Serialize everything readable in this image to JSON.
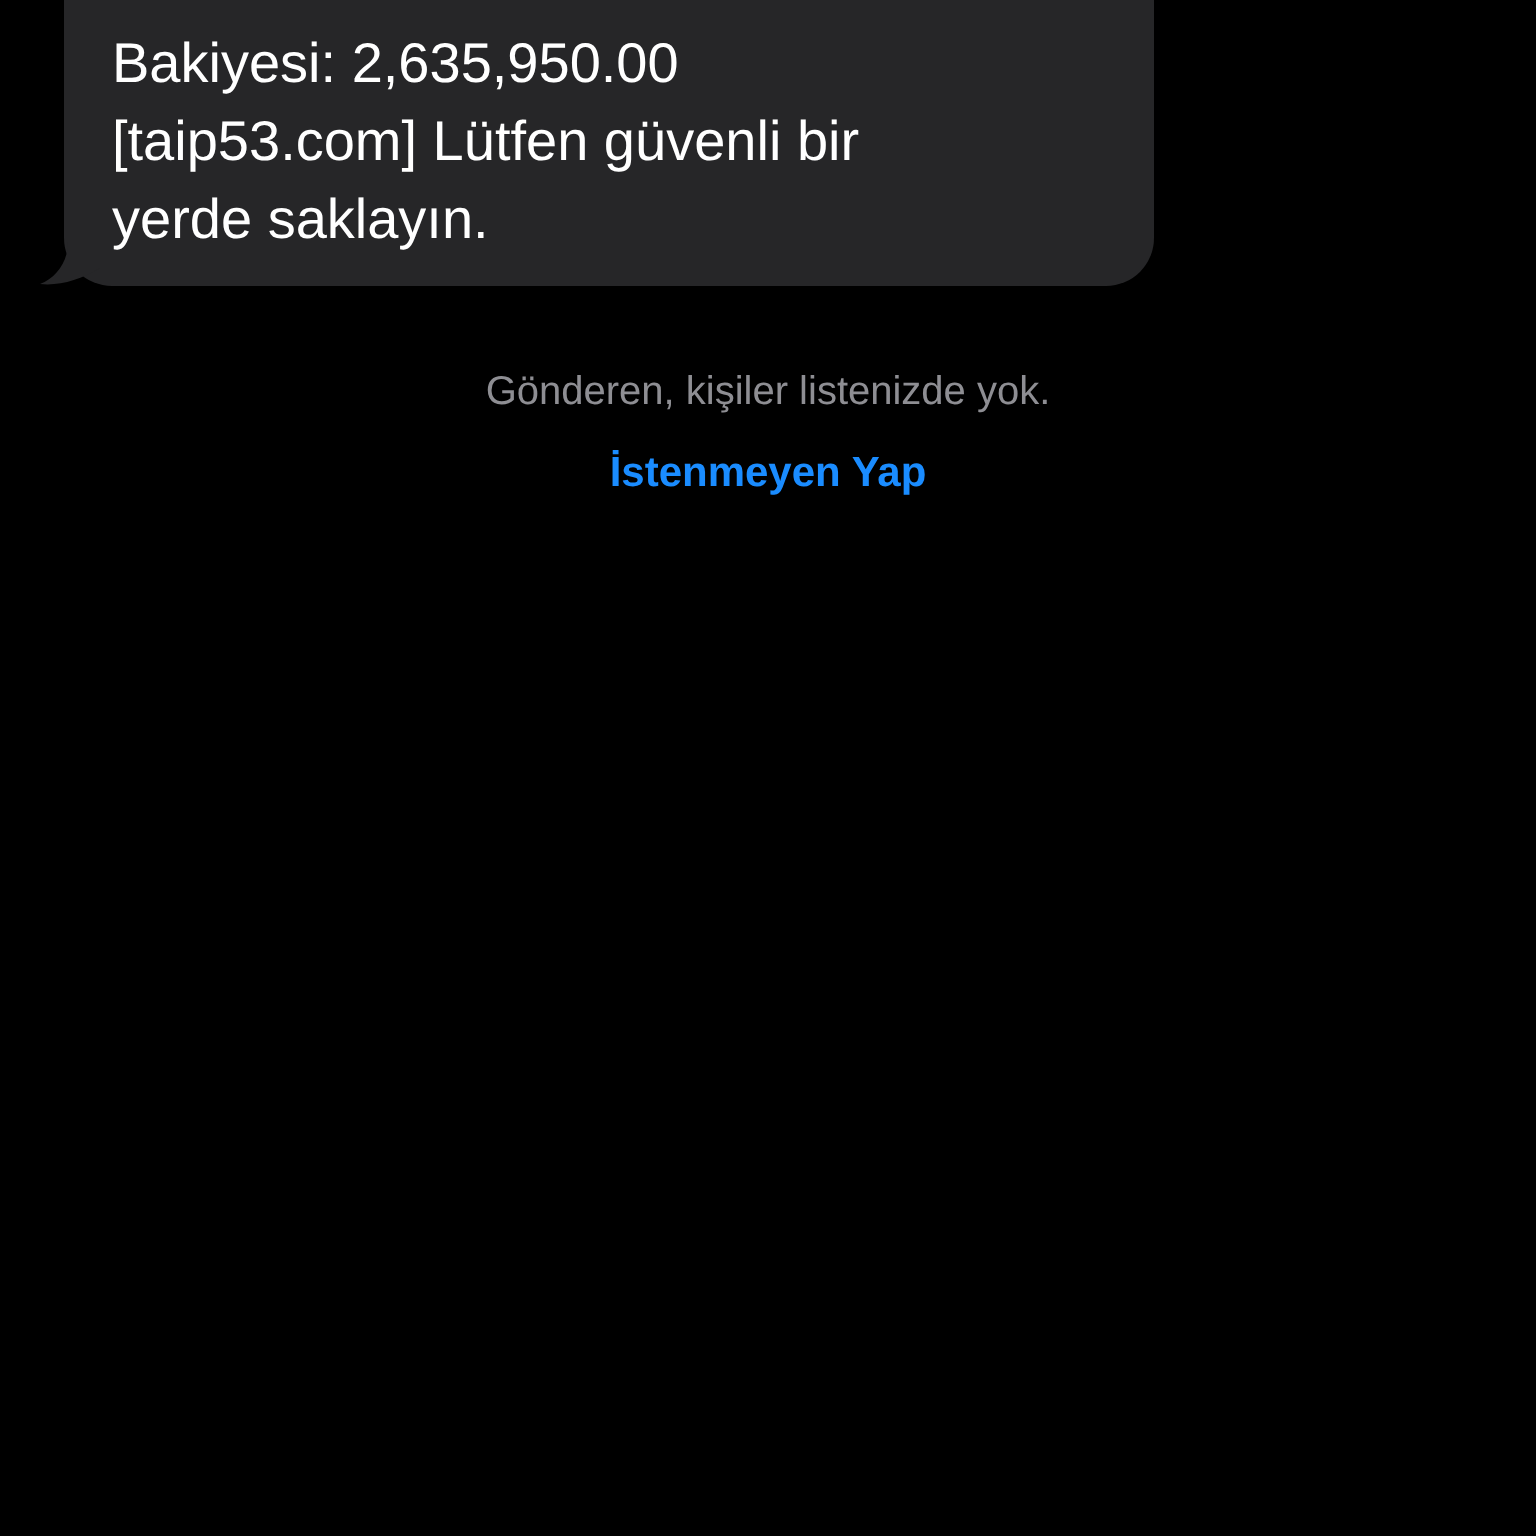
{
  "message": {
    "lines": [
      "Bakiyesi: 2,635,950.00",
      "[taip53.com] Lütfen güvenli bir",
      "yerde saklayın."
    ]
  },
  "notice": {
    "text": "Gönderen, kişiler listenizde yok.",
    "action": "İstenmeyen Yap"
  }
}
